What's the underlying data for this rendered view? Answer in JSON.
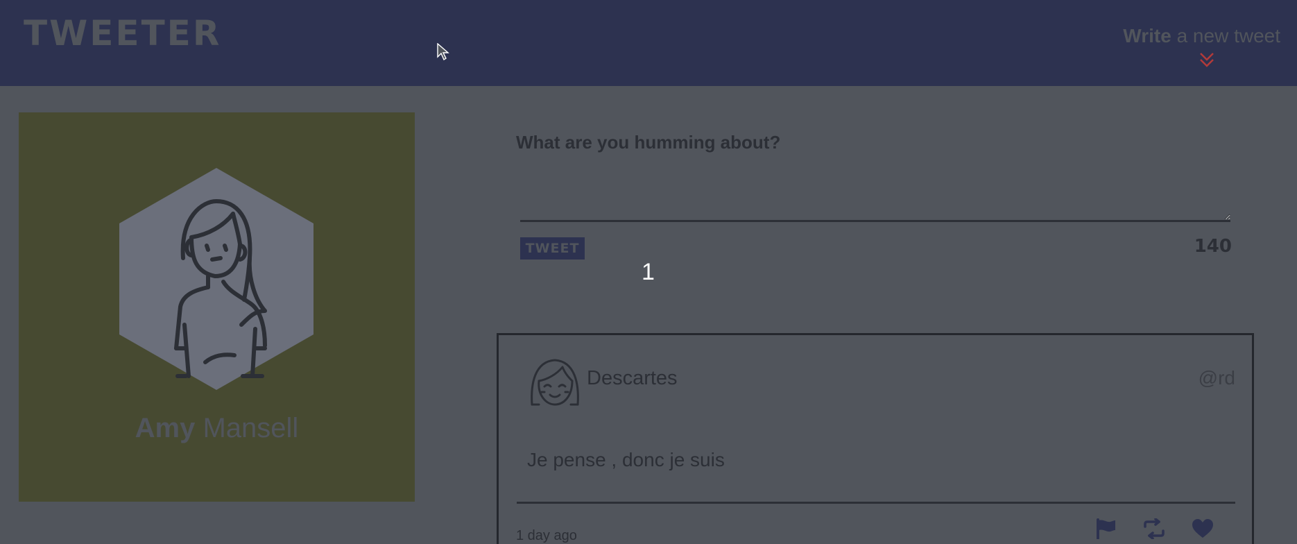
{
  "nav": {
    "brand": "TWEETER",
    "compose_toggle": {
      "bold": "Write",
      "rest": " a new tweet"
    },
    "chevron_icon": "double-chevron-down-icon"
  },
  "profile": {
    "first_name": "Amy",
    "last_name": " Mansell",
    "avatar_icon": "girl-avatar-icon",
    "card_color": "#474a31"
  },
  "composer": {
    "label": "What are you humming about?",
    "textarea_value": "",
    "button_label": "TWEET",
    "char_count": "140",
    "floating_count": "1"
  },
  "tweets": [
    {
      "author": "Descartes",
      "handle": "@rd",
      "text": "Je pense , donc je suis",
      "time": "1 day ago",
      "avatar_icon": "smiling-girl-avatar-icon",
      "actions": [
        "flag-icon",
        "retweet-icon",
        "heart-icon"
      ]
    }
  ],
  "colors": {
    "nav": "#2d3250",
    "page": "#51555c",
    "accent_red": "#b23a3a"
  }
}
